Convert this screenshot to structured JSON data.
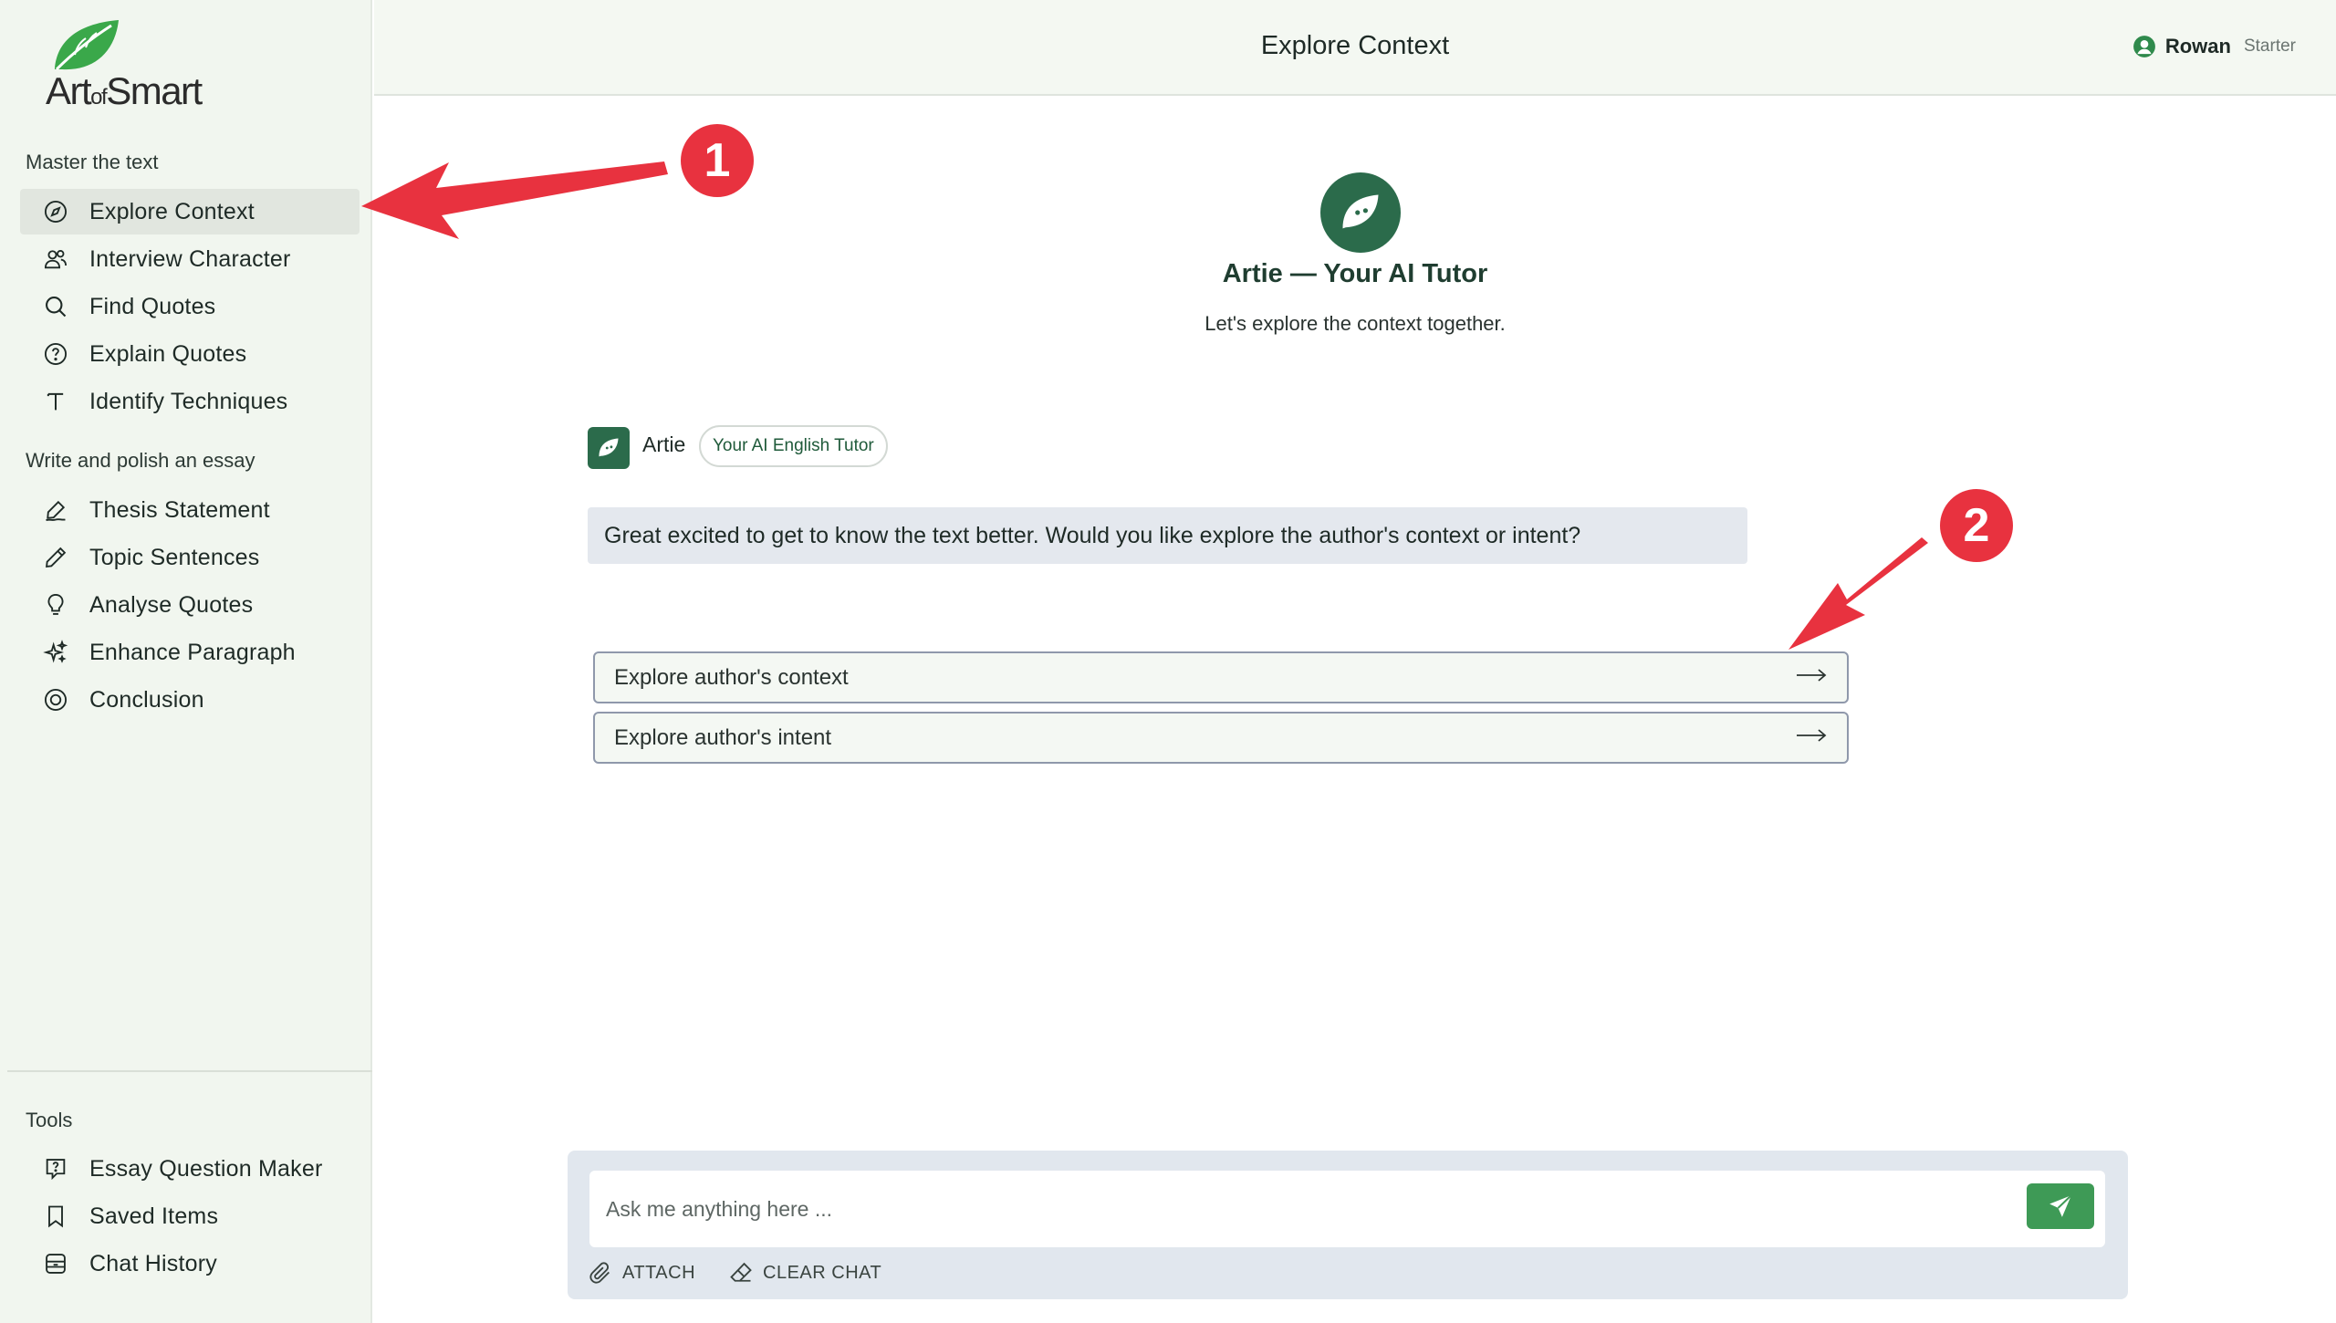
{
  "logo": {
    "text_main_1": "Art",
    "text_of": "of",
    "text_main_2": "Smart",
    "icon": "leaf-icon"
  },
  "sidebar": {
    "section_master": "Master the text",
    "master_items": [
      {
        "label": "Explore Context",
        "icon": "compass-icon",
        "active": true
      },
      {
        "label": "Interview Character",
        "icon": "users-icon"
      },
      {
        "label": "Find Quotes",
        "icon": "search-icon"
      },
      {
        "label": "Explain Quotes",
        "icon": "question-circle-icon"
      },
      {
        "label": "Identify Techniques",
        "icon": "type-icon"
      }
    ],
    "section_write": "Write and polish an essay",
    "write_items": [
      {
        "label": "Thesis Statement",
        "icon": "signature-icon"
      },
      {
        "label": "Topic Sentences",
        "icon": "pencil-icon"
      },
      {
        "label": "Analyse Quotes",
        "icon": "lightbulb-icon"
      },
      {
        "label": "Enhance Paragraph",
        "icon": "sparkles-icon"
      },
      {
        "label": "Conclusion",
        "icon": "target-icon"
      }
    ],
    "section_tools": "Tools",
    "tools_items": [
      {
        "label": "Essay Question Maker",
        "icon": "message-question-icon"
      },
      {
        "label": "Saved Items",
        "icon": "bookmark-icon"
      },
      {
        "label": "Chat History",
        "icon": "archive-icon"
      }
    ]
  },
  "header": {
    "title": "Explore Context",
    "user_name": "Rowan",
    "plan": "Starter"
  },
  "hero": {
    "title": "Artie — Your AI Tutor",
    "subtitle": "Let's explore the context together."
  },
  "chat": {
    "sender": "Artie",
    "badge": "Your AI English Tutor",
    "message": "Great excited to get to know the text better. Would you like explore the author's context or intent?",
    "options": [
      "Explore author's context",
      "Explore author's intent"
    ]
  },
  "composer": {
    "placeholder": "Ask me anything here ...",
    "attach_label": "ATTACH",
    "clear_label": "CLEAR CHAT"
  },
  "annotations": {
    "callout_1": "1",
    "callout_2": "2"
  },
  "colors": {
    "brand_green": "#2b6b4b",
    "send_green": "#3e9a56",
    "callout_red": "#e8323f",
    "sidebar_bg": "#f1f6ef"
  }
}
